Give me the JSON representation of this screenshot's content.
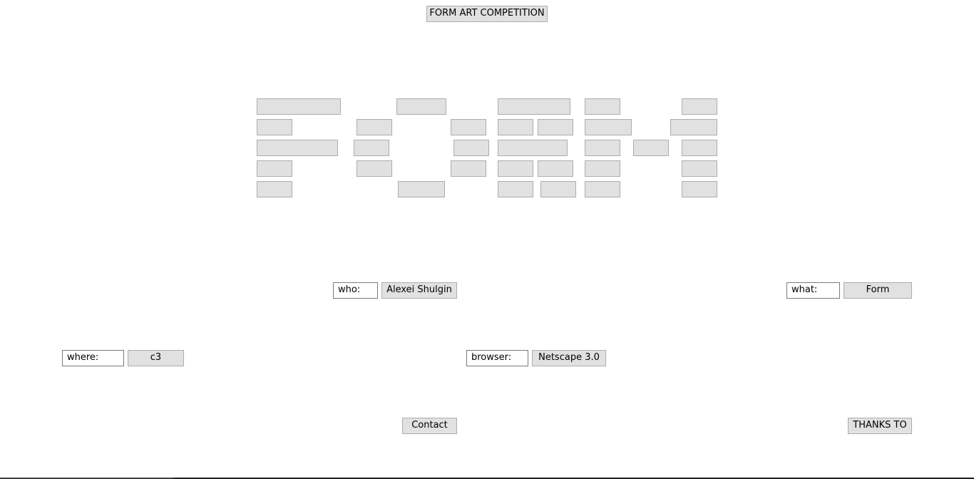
{
  "header": {
    "title_label": "FORM ART COMPETITION"
  },
  "who": {
    "field_value": "who:",
    "button_label": "Alexei Shulgin"
  },
  "what": {
    "field_value": "what:",
    "button_label": "Form"
  },
  "where": {
    "field_value": "where:",
    "button_label": "c3"
  },
  "browser": {
    "field_value": "browser:",
    "button_label": "Netscape 3.0"
  },
  "footer": {
    "contact_label": "Contact",
    "thanks_label": "THANKS TO"
  },
  "colors": {
    "button_face": "#e1e1e1",
    "button_border": "#adadad",
    "field_border": "#7a7a7a",
    "background": "#ffffff"
  }
}
